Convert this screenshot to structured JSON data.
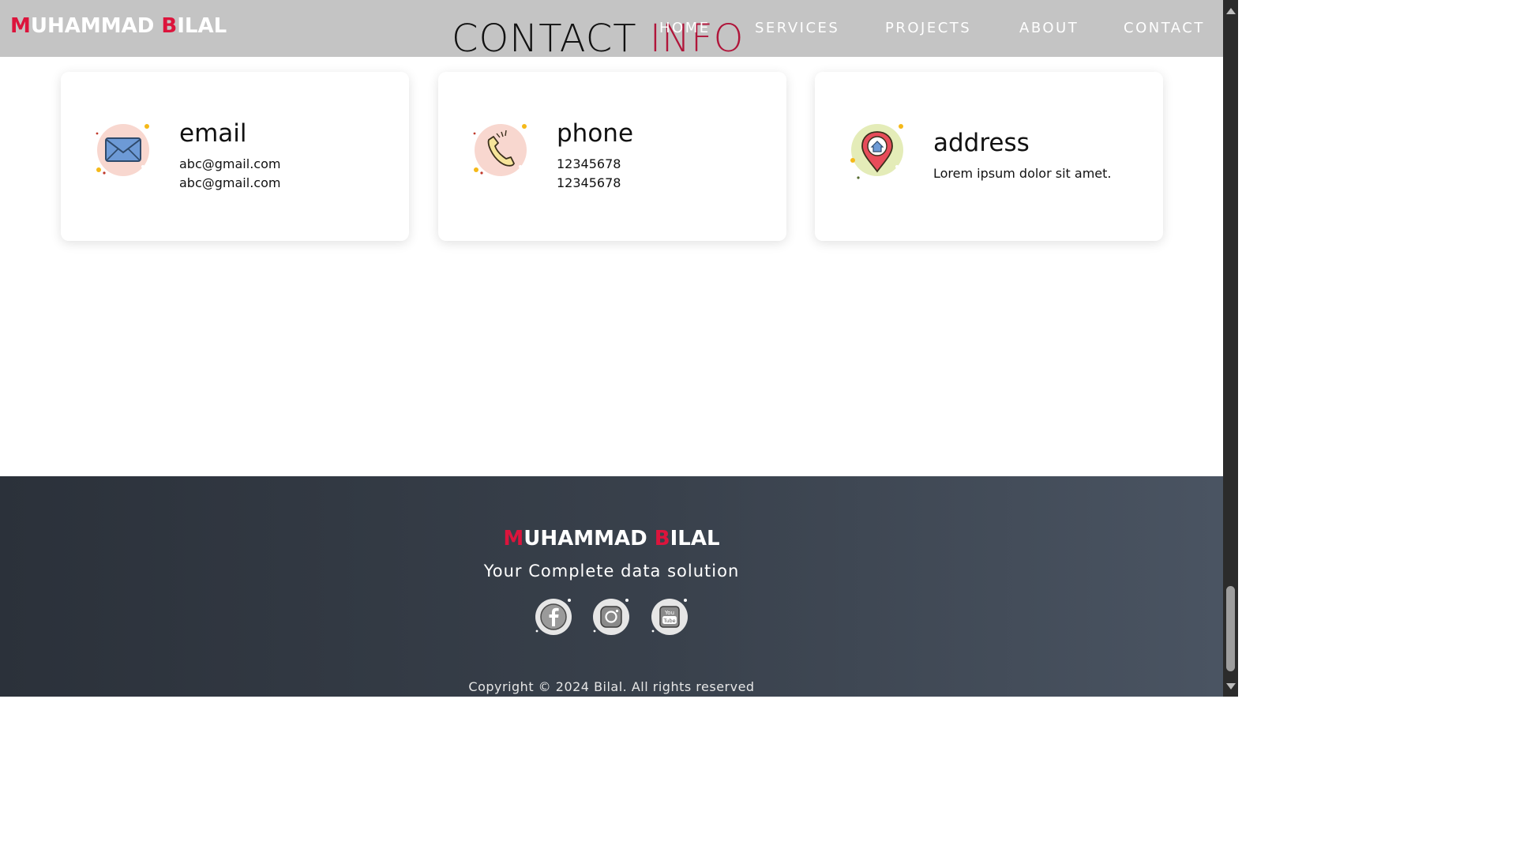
{
  "header": {
    "logo_first_initial": "M",
    "logo_first_rest": "UHAMMAD ",
    "logo_second_initial": "B",
    "logo_second_rest": "ILAL",
    "section_title_part1": "CONTACT ",
    "section_title_part2": "INFO",
    "nav": [
      {
        "label": "HOME"
      },
      {
        "label": "SERVICES"
      },
      {
        "label": "PROJECTS"
      },
      {
        "label": "ABOUT"
      },
      {
        "label": "CONTACT"
      }
    ]
  },
  "cards": [
    {
      "title": "email",
      "lines": [
        "abc@gmail.com",
        "abc@gmail.com"
      ],
      "icon": "envelope-icon"
    },
    {
      "title": "phone",
      "lines": [
        "12345678",
        "12345678"
      ],
      "icon": "phone-icon"
    },
    {
      "title": "address",
      "lines": [
        "Lorem ipsum dolor sit amet."
      ],
      "icon": "location-pin-icon"
    }
  ],
  "footer": {
    "logo_first_initial": "M",
    "logo_first_rest": "UHAMMAD ",
    "logo_second_initial": "B",
    "logo_second_rest": "ILAL",
    "tagline": "Your Complete data solution",
    "social": [
      {
        "icon": "facebook-icon"
      },
      {
        "icon": "instagram-icon"
      },
      {
        "icon": "youtube-icon"
      }
    ],
    "copyright": "Copyright © 2024 Bilal. All rights reserved"
  },
  "colors": {
    "accent": "#dc143c",
    "header_bg": "#c4c4c4",
    "footer_bg": "#343b45"
  }
}
